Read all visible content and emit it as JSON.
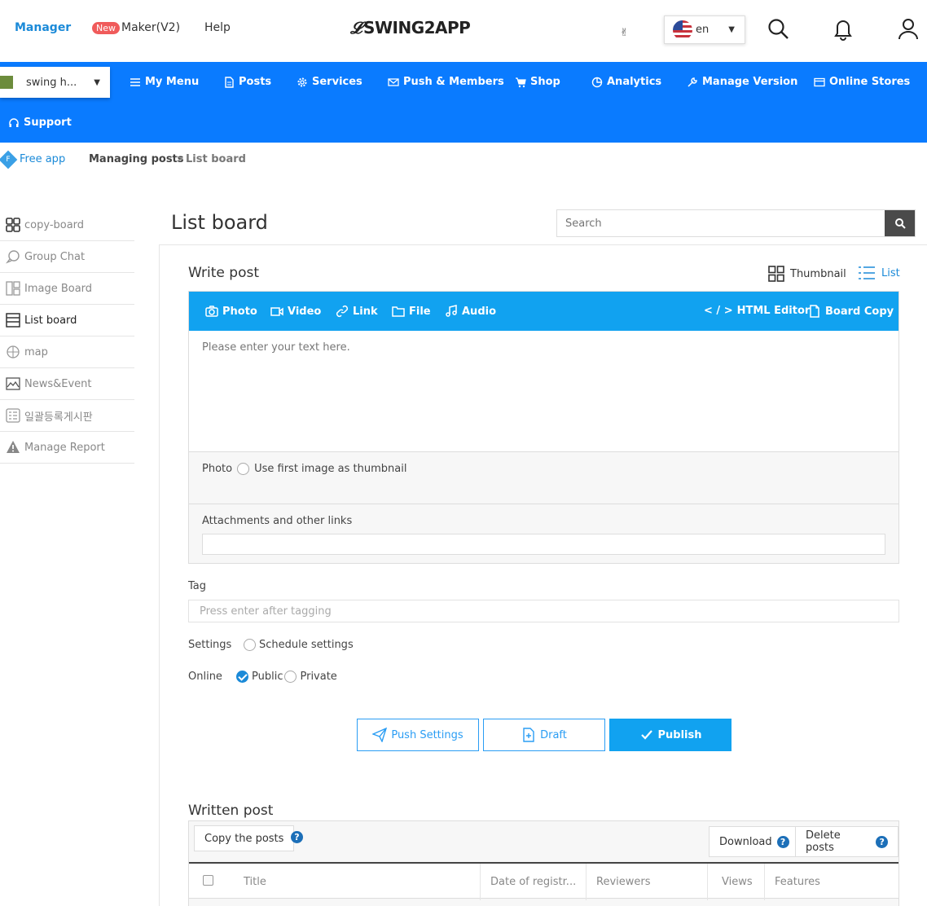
{
  "header": {
    "manager": "Manager",
    "new_badge": "New",
    "maker": "Maker(V2)",
    "help": "Help",
    "logo": "SWING2APP",
    "language": "en"
  },
  "nav": {
    "app_name": "swing h...",
    "items": [
      "My Menu",
      "Posts",
      "Services",
      "Push & Members",
      "Shop",
      "Analytics",
      "Manage Version",
      "Online Stores",
      "Support"
    ]
  },
  "breadcrumb": {
    "badge": "F",
    "app_type": "Free app",
    "section": "Managing posts",
    "separator": ">",
    "current": "List board"
  },
  "sidebar": {
    "items": [
      "copy-board",
      "Group Chat",
      "Image Board",
      "List board",
      "map",
      "News&Event",
      "일괄등록게시판",
      "Manage Report"
    ],
    "active": "List board"
  },
  "page": {
    "title": "List board",
    "search_placeholder": "Search"
  },
  "write": {
    "title": "Write post",
    "view_thumbnail": "Thumbnail",
    "view_list": "List",
    "toolbar": [
      "Photo",
      "Video",
      "Link",
      "File",
      "Audio",
      "HTML Editor",
      "Board Copy"
    ],
    "body_placeholder": "Please enter your text here.",
    "photo_label": "Photo",
    "thumbnail_option": "Use first image as thumbnail",
    "attachments_label": "Attachments and other links",
    "tag_label": "Tag",
    "tag_placeholder": "Press enter after tagging",
    "settings_label": "Settings",
    "schedule_option": "Schedule settings",
    "online_label": "Online",
    "public_option": "Public",
    "private_option": "Private",
    "online_selected": "Public",
    "buttons": {
      "push": "Push Settings",
      "draft": "Draft",
      "publish": "Publish"
    }
  },
  "written": {
    "title": "Written post",
    "copy_button": "Copy the posts",
    "download_button": "Download",
    "delete_button": "Delete posts",
    "help_glyph": "?",
    "columns": [
      "Title",
      "Date of registr...",
      "Reviewers",
      "Views",
      "Features"
    ]
  },
  "colors": {
    "nav_blue": "#0a7bff",
    "toolbar_blue": "#11a2f0",
    "link_blue": "#1b8ad8",
    "badge_red": "#f05b5b"
  }
}
